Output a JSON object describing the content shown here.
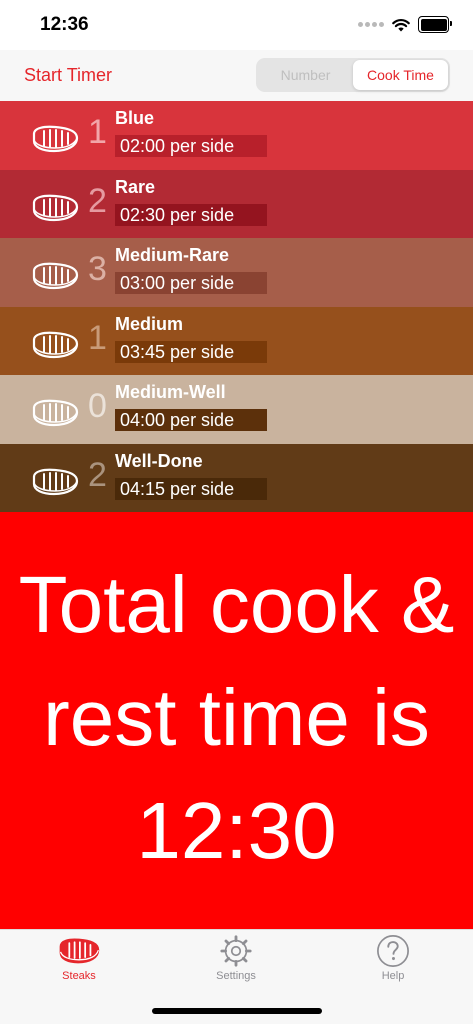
{
  "status_bar": {
    "time": "12:36"
  },
  "nav": {
    "start_timer": "Start Timer",
    "segments": [
      {
        "label": "Number",
        "selected": false
      },
      {
        "label": "Cook Time",
        "selected": true
      }
    ]
  },
  "steaks": [
    {
      "count": "1",
      "name": "Blue",
      "time": "02:00 per side",
      "bg": "#d8343c",
      "time_bg": "#b8202b",
      "count_color": "#f2a6a9"
    },
    {
      "count": "2",
      "name": "Rare",
      "time": "02:30 per side",
      "bg": "#b22a34",
      "time_bg": "#94141f",
      "count_color": "#e59aa0"
    },
    {
      "count": "3",
      "name": "Medium-Rare",
      "time": "03:00 per side",
      "bg": "#a65e4a",
      "time_bg": "#8a4332",
      "count_color": "#dbb0a4"
    },
    {
      "count": "1",
      "name": "Medium",
      "time": "03:45 per side",
      "bg": "#96501c",
      "time_bg": "#7a3a09",
      "count_color": "#c99b78"
    },
    {
      "count": "0",
      "name": "Medium-Well",
      "time": "04:00 per side",
      "bg": "#c9b39e",
      "time_bg": "#5c300b",
      "count_color": "#ebe2d9"
    },
    {
      "count": "2",
      "name": "Well-Done",
      "time": "04:15 per side",
      "bg": "#613b17",
      "time_bg": "#4a2909",
      "count_color": "#aa937e"
    }
  ],
  "total": {
    "line1": "Total cook &",
    "line2": "rest time is",
    "line3": "12:30"
  },
  "tabs": [
    {
      "label": "Steaks",
      "active": true,
      "icon": "steak-icon"
    },
    {
      "label": "Settings",
      "active": false,
      "icon": "gear-icon"
    },
    {
      "label": "Help",
      "active": false,
      "icon": "question-circle-icon"
    }
  ],
  "colors": {
    "accent": "#e5262b",
    "total_bg": "#ff0000",
    "tab_inactive": "#8e8e93"
  }
}
